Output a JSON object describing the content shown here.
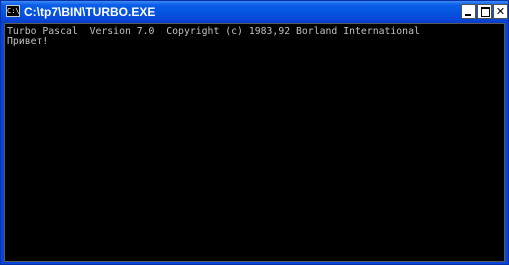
{
  "window": {
    "title": "C:\\tp7\\BIN\\TURBO.EXE",
    "icon": "console-icon",
    "icon_label": "C:\\",
    "controls": {
      "minimize": "minimize-icon",
      "maximize": "maximize-icon",
      "close": "close-icon"
    }
  },
  "console": {
    "lines": [
      "Turbo Pascal  Version 7.0  Copyright (c) 1983,92 Borland International",
      "Привет!"
    ],
    "text_color": "#c0c0c0",
    "background_color": "#000000"
  }
}
